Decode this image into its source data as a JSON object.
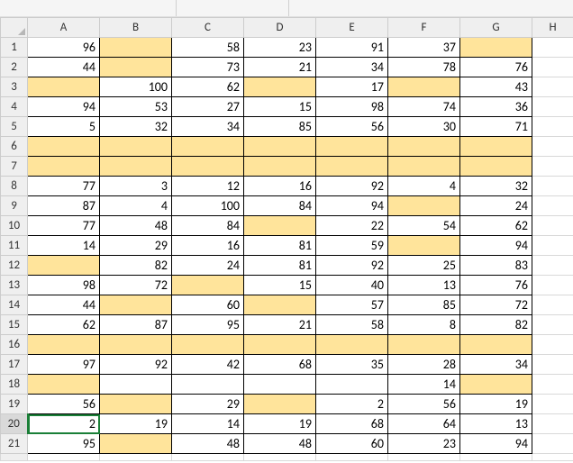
{
  "chart_data": {
    "type": "table",
    "columns": [
      "A",
      "B",
      "C",
      "D",
      "E",
      "F",
      "G"
    ],
    "row_numbers": [
      1,
      2,
      3,
      4,
      5,
      6,
      7,
      8,
      9,
      10,
      11,
      12,
      13,
      14,
      15,
      16,
      17,
      18,
      19,
      20,
      21
    ],
    "data": [
      [
        96,
        null,
        58,
        23,
        91,
        37,
        null
      ],
      [
        44,
        null,
        73,
        21,
        34,
        78,
        76
      ],
      [
        null,
        100,
        62,
        null,
        17,
        null,
        43
      ],
      [
        94,
        53,
        27,
        15,
        98,
        74,
        36
      ],
      [
        5,
        32,
        34,
        85,
        56,
        30,
        71
      ],
      [
        null,
        null,
        null,
        null,
        null,
        null,
        null
      ],
      [
        null,
        null,
        null,
        null,
        null,
        null,
        null
      ],
      [
        77,
        3,
        12,
        16,
        92,
        4,
        32
      ],
      [
        87,
        4,
        100,
        84,
        94,
        null,
        24
      ],
      [
        77,
        48,
        84,
        null,
        22,
        54,
        62
      ],
      [
        14,
        29,
        16,
        81,
        59,
        null,
        94
      ],
      [
        null,
        82,
        24,
        81,
        92,
        25,
        83
      ],
      [
        98,
        72,
        null,
        15,
        40,
        13,
        76
      ],
      [
        44,
        null,
        60,
        null,
        57,
        85,
        72
      ],
      [
        62,
        87,
        95,
        21,
        58,
        8,
        82
      ],
      [
        null,
        null,
        null,
        null,
        null,
        null,
        null
      ],
      [
        97,
        92,
        42,
        68,
        35,
        28,
        34
      ],
      [
        null,
        null,
        null,
        null,
        null,
        14,
        null
      ],
      [
        56,
        null,
        29,
        null,
        2,
        56,
        19
      ],
      [
        2,
        19,
        14,
        19,
        68,
        64,
        13
      ],
      [
        95,
        null,
        48,
        48,
        60,
        23,
        94
      ]
    ],
    "highlighted_cells": [
      [
        1,
        "B"
      ],
      [
        1,
        "G"
      ],
      [
        2,
        "B"
      ],
      [
        3,
        "A"
      ],
      [
        3,
        "D"
      ],
      [
        3,
        "F"
      ],
      [
        6,
        "A"
      ],
      [
        6,
        "B"
      ],
      [
        6,
        "C"
      ],
      [
        6,
        "D"
      ],
      [
        6,
        "E"
      ],
      [
        6,
        "F"
      ],
      [
        6,
        "G"
      ],
      [
        7,
        "A"
      ],
      [
        7,
        "B"
      ],
      [
        7,
        "C"
      ],
      [
        7,
        "D"
      ],
      [
        7,
        "E"
      ],
      [
        7,
        "F"
      ],
      [
        7,
        "G"
      ],
      [
        9,
        "F"
      ],
      [
        10,
        "D"
      ],
      [
        11,
        "F"
      ],
      [
        12,
        "A"
      ],
      [
        13,
        "C"
      ],
      [
        14,
        "B"
      ],
      [
        14,
        "D"
      ],
      [
        16,
        "A"
      ],
      [
        16,
        "B"
      ],
      [
        16,
        "C"
      ],
      [
        16,
        "D"
      ],
      [
        16,
        "E"
      ],
      [
        16,
        "F"
      ],
      [
        16,
        "G"
      ],
      [
        18,
        "A"
      ],
      [
        18,
        "G"
      ],
      [
        19,
        "B"
      ],
      [
        19,
        "D"
      ],
      [
        21,
        "B"
      ]
    ]
  },
  "columns_display": {
    "A": "A",
    "B": "B",
    "C": "C",
    "D": "D",
    "E": "E",
    "F": "F",
    "G": "G",
    "H": "H"
  },
  "active_cell": {
    "row": 20,
    "col": "A"
  }
}
